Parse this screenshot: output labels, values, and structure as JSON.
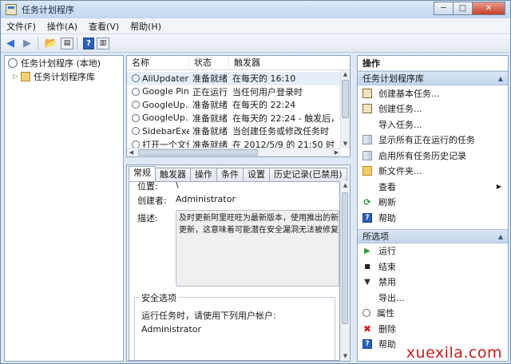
{
  "window": {
    "title": "任务计划程序",
    "controls": {
      "minimize": "─",
      "maximize": "□",
      "close": "✕"
    }
  },
  "menu": [
    "文件(F)",
    "操作(A)",
    "查看(V)",
    "帮助(H)"
  ],
  "tree": {
    "root": "任务计划程序 (本地)",
    "child": "任务计划程序库"
  },
  "task_list": {
    "columns": [
      "名称",
      "状态",
      "触发器"
    ],
    "rows": [
      {
        "name": "AliUpdater(...",
        "status": "准备就绪",
        "trigger": "在每天的 16:10"
      },
      {
        "name": "Google Pin...",
        "status": "正在运行",
        "trigger": "当任何用户登录时"
      },
      {
        "name": "GoogleUp...",
        "status": "准备就绪",
        "trigger": "在每天的 22:24"
      },
      {
        "name": "GoogleUp...",
        "status": "准备就绪",
        "trigger": "在每天的 22:24 - 触发后，在 1"
      },
      {
        "name": "SidebarExe...",
        "status": "准备就绪",
        "trigger": "当创建任务或修改任务时"
      },
      {
        "name": "打开一个文件",
        "status": "准备就绪",
        "trigger": "在 2012/5/9 的 21:50 时"
      }
    ]
  },
  "detail": {
    "tabs": [
      "常规",
      "触发器",
      "操作",
      "条件",
      "设置",
      "历史记录(已禁用)"
    ],
    "location_label": "位置:",
    "location_value": "\\",
    "author_label": "创建者:",
    "author_value": "Administrator",
    "description_label": "描述:",
    "description_lines": [
      "及时更新阿里旺旺为最新版本，使用推出的新功能",
      "更新，这意味着可能潜在安全漏洞无法被修复，!"
    ],
    "security_title": "安全选项",
    "run_as_label": "运行任务时，请使用下列用户帐户:",
    "run_as_value": "Administrator"
  },
  "actions": {
    "title": "操作",
    "library_section": "任务计划程序库",
    "library_items": [
      {
        "icon": "create-basic-task-icon",
        "label": "创建基本任务..."
      },
      {
        "icon": "create-task-icon",
        "label": "创建任务..."
      },
      {
        "icon": "import-icon",
        "label": "导入任务..."
      },
      {
        "icon": "show-running-icon",
        "label": "显示所有正在运行的任务"
      },
      {
        "icon": "history-icon",
        "label": "启用所有任务历史记录"
      },
      {
        "icon": "new-folder-icon",
        "label": "新文件夹..."
      },
      {
        "icon": "view-icon",
        "label": "查看"
      },
      {
        "icon": "refresh-icon",
        "label": "刷新"
      },
      {
        "icon": "help-icon",
        "label": "帮助"
      }
    ],
    "selected_section": "所选项",
    "selected_items": [
      {
        "icon": "run-icon",
        "label": "运行"
      },
      {
        "icon": "end-icon",
        "label": "结束"
      },
      {
        "icon": "disable-icon",
        "label": "禁用"
      },
      {
        "icon": "export-icon",
        "label": "导出..."
      },
      {
        "icon": "properties-icon",
        "label": "属性"
      },
      {
        "icon": "delete-icon",
        "label": "删除"
      },
      {
        "icon": "help-icon",
        "label": "帮助"
      }
    ]
  },
  "watermark": "xuexila.com",
  "colors": {
    "accent": "#2f6fd0",
    "section_header": "#c3d5ec",
    "watermark": "#c71c1c"
  }
}
